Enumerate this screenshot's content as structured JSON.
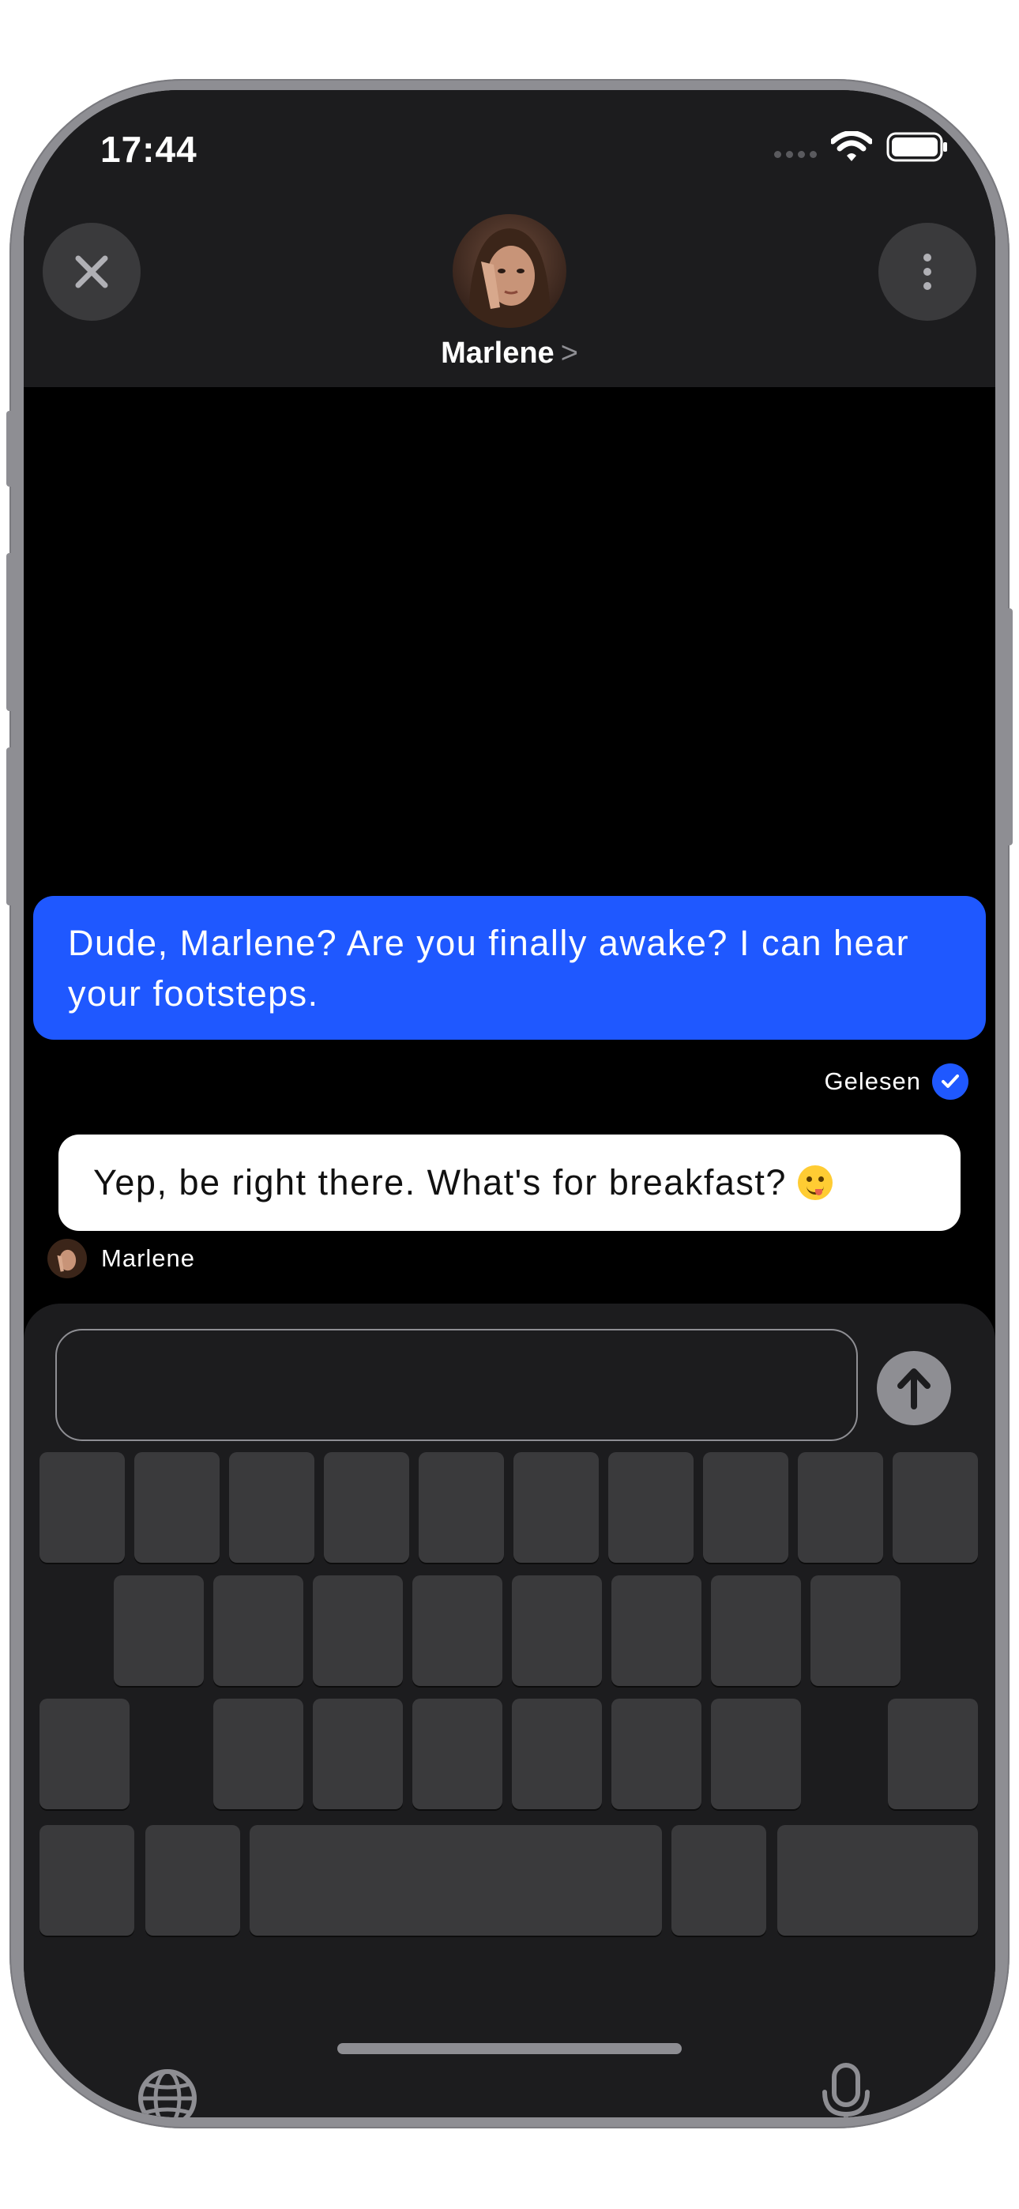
{
  "status_bar": {
    "time": "17:44"
  },
  "header": {
    "contact_name": "Marlene",
    "chevron": ">",
    "close_icon": "close-icon",
    "more_icon": "more-vertical-icon"
  },
  "messages": [
    {
      "direction": "outgoing",
      "text": "Dude, Marlene? Are you finally awake? I can hear your footsteps."
    },
    {
      "direction": "incoming",
      "text": "Yep, be right there. What's for breakfast?",
      "emoji": "yum-face-emoji",
      "sender": "Marlene"
    }
  ],
  "read_receipt": {
    "label": "Gelesen"
  },
  "composer": {
    "value": "",
    "placeholder": ""
  },
  "colors": {
    "accent": "#1f58ff",
    "bubble_in": "#ffffff",
    "key": "#3a3a3c",
    "keyboard_bg": "#1c1c1e"
  },
  "keyboard": {
    "globe_icon": "globe-icon",
    "mic_icon": "microphone-icon"
  }
}
